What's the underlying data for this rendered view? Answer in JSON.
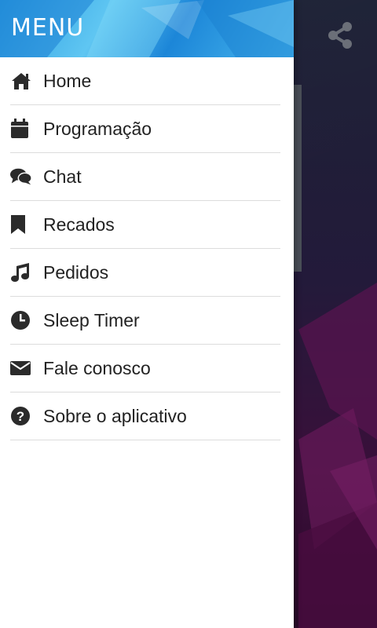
{
  "drawer": {
    "title": "MENU",
    "items": [
      {
        "label": "Home",
        "icon": "home-icon"
      },
      {
        "label": "Programação",
        "icon": "calendar-icon"
      },
      {
        "label": "Chat",
        "icon": "chat-icon"
      },
      {
        "label": "Recados",
        "icon": "bookmark-icon"
      },
      {
        "label": "Pedidos",
        "icon": "music-note-icon"
      },
      {
        "label": "Sleep Timer",
        "icon": "clock-icon"
      },
      {
        "label": "Fale conosco",
        "icon": "envelope-icon"
      },
      {
        "label": "Sobre o aplicativo",
        "icon": "question-circle-icon"
      }
    ]
  },
  "header_actions": {
    "share_icon": "share-icon"
  },
  "colors": {
    "header_accent": "#2a9be0",
    "icon": "#2b2b2b",
    "text": "#222222",
    "divider": "#dcdcdc"
  }
}
